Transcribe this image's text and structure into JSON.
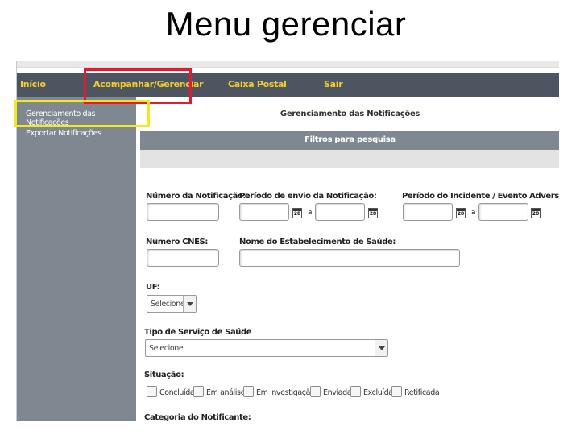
{
  "slide_title": "Menu gerenciar",
  "navbar": {
    "items": [
      "Início",
      "Acompanhar/Gerenciar",
      "Caixa Postal",
      "Sair"
    ]
  },
  "sidebar": {
    "items": [
      "Gerenciamento das Notificações",
      "Exportar Notificações"
    ]
  },
  "main": {
    "title": "Gerenciamento das Notificações",
    "filter_header": "Filtros para pesquisa"
  },
  "form": {
    "numero_notificacao_label": "Número da Notificação:",
    "periodo_envio_label": "Período de envio da Notificação:",
    "periodo_incidente_label": "Período do Incidente / Evento Adverso:",
    "date_separator": "a",
    "calendar_icon_text": "28",
    "numero_cnes_label": "Número CNES:",
    "nome_estabelecimento_label": "Nome do Estabelecimento de Saúde:",
    "uf_label": "UF:",
    "uf_value": "Selecione",
    "tipo_servico_label": "Tipo de Serviço de Saúde",
    "tipo_servico_value": "Selecione",
    "situacao_label": "Situação:",
    "situacao_options": [
      "Concluída",
      "Em análise",
      "Em investigação",
      "Enviada",
      "Excluída",
      "Retificada"
    ],
    "categoria_label": "Categoria do Notificante:"
  },
  "colors": {
    "navbar_bg": "#4c5560",
    "nav_text": "#f4cf2a",
    "sidebar_bg": "#7f8890",
    "highlight_red": "#e8192c",
    "highlight_yellow": "#f2ea1d"
  }
}
